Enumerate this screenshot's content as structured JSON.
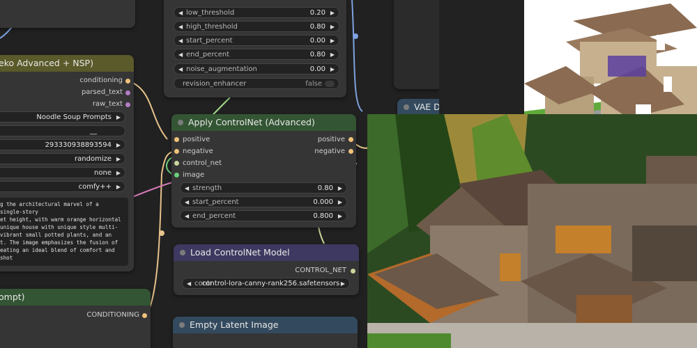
{
  "top_left_node": {},
  "prompt_node": {
    "title": "eko Advanced + NSP)",
    "outputs": [
      "conditioning",
      "parsed_text",
      "raw_text"
    ],
    "widgets": [
      {
        "value": "Noodle Soup Prompts"
      },
      {
        "value": "__"
      },
      {
        "value": "293330938893594"
      },
      {
        "value": "randomize"
      },
      {
        "value": "none"
      },
      {
        "value": "comfy++"
      }
    ],
    "prompt_lines": [
      "g the architectural marvel of a single-story",
      "et height, with warm orange horizontal",
      " unique house with unique style multi-",
      "vibrant small potted plants, and an",
      "t. The image emphasizes the fusion of",
      "eating an ideal blend of comfort and",
      " shot"
    ]
  },
  "canny_node": {
    "widgets": [
      {
        "label": "low_threshold",
        "value": "0.20"
      },
      {
        "label": "high_threshold",
        "value": "0.80"
      },
      {
        "label": "start_percent",
        "value": "0.00"
      },
      {
        "label": "end_percent",
        "value": "0.80"
      },
      {
        "label": "noise_augmentation",
        "value": "0.00"
      }
    ],
    "toggle": {
      "label": "revision_enhancer",
      "value": "false"
    }
  },
  "apply_controlnet": {
    "title": "Apply ControlNet (Advanced)",
    "inputs": [
      "positive",
      "negative",
      "control_net",
      "image"
    ],
    "outputs": [
      "positive",
      "negative"
    ],
    "widgets": [
      {
        "label": "strength",
        "value": "0.80"
      },
      {
        "label": "start_percent",
        "value": "0.000"
      },
      {
        "label": "end_percent",
        "value": "0.800"
      }
    ]
  },
  "load_controlnet": {
    "title": "Load ControlNet Model",
    "output": "CONTROL_NET",
    "widget_label": "contr",
    "widget_value": "control-lora-canny-rank256.safetensors"
  },
  "negative_node": {
    "title": "ompt)",
    "output": "CONDITIONING"
  },
  "latent_node": {
    "title": "Empty Latent Image"
  },
  "vae_node": {
    "title": "VAE D"
  },
  "colors": {
    "canvas": "#212121",
    "node_body": "#353535",
    "widget_bg": "#222222",
    "header_olive": "#5a5a2a",
    "header_green": "#335533",
    "header_purple": "#3e3960",
    "header_blue": "#334a5e",
    "wire_conditioning": "#e8c28c",
    "wire_pink": "#d77bb8",
    "wire_blue": "#7ea3e0",
    "wire_green": "#a6e08d"
  }
}
